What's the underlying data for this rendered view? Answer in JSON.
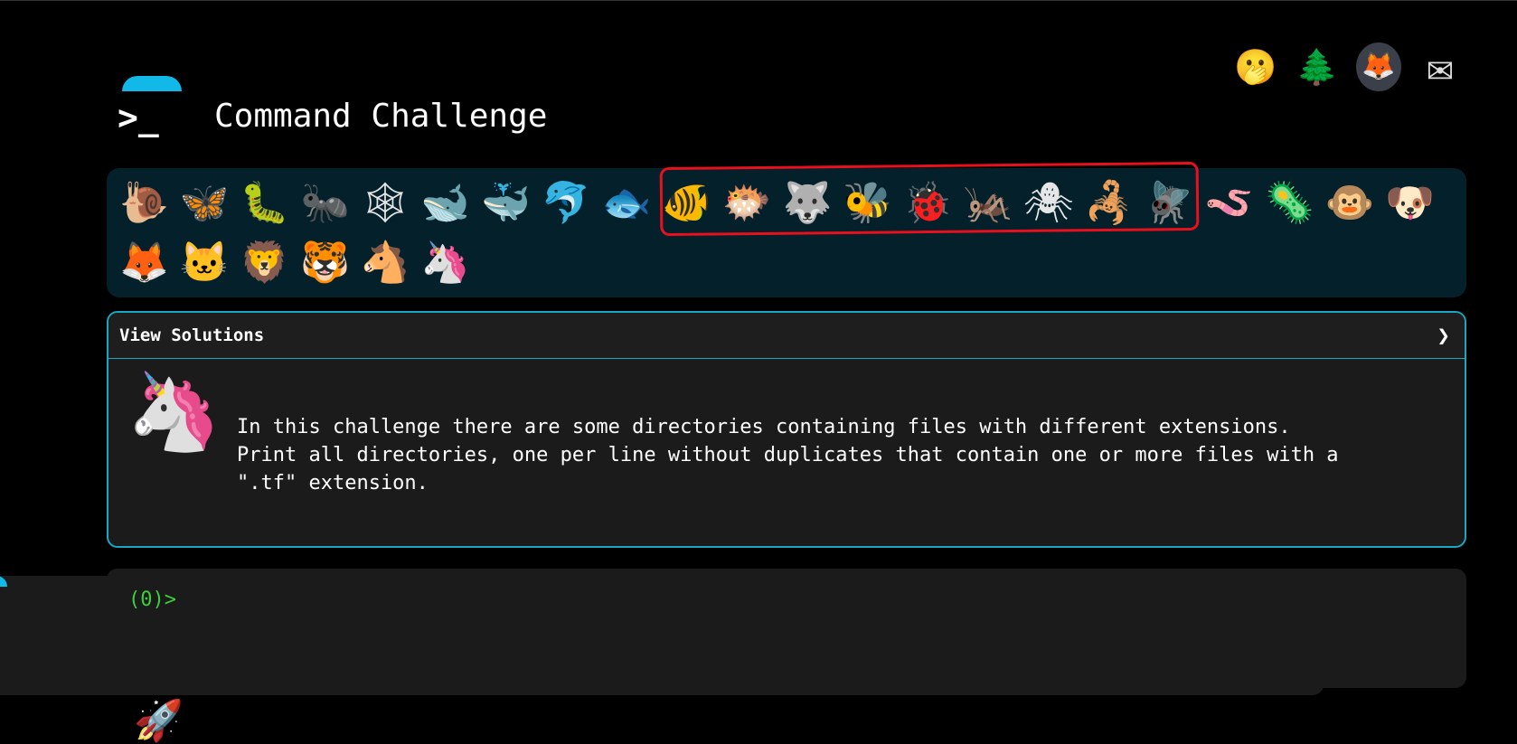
{
  "site": {
    "title": "Command Challenge",
    "logo_glyph": ">_"
  },
  "top_nav": {
    "items": [
      {
        "name": "terminal-icon",
        "glyph": ">_"
      },
      {
        "name": "shushing-face-icon",
        "glyph": "🫢"
      },
      {
        "name": "tree-icon",
        "glyph": "🌲"
      },
      {
        "name": "gitlab-icon",
        "glyph": "🦊"
      },
      {
        "name": "mail-icon",
        "glyph": "✉"
      }
    ]
  },
  "animals": {
    "row1": [
      {
        "name": "snail-icon",
        "glyph": "🐌"
      },
      {
        "name": "butterfly-icon",
        "glyph": "🦋"
      },
      {
        "name": "caterpillar-icon",
        "glyph": "🐛"
      },
      {
        "name": "ant-icon",
        "glyph": "🐜"
      },
      {
        "name": "spider-web-icon",
        "glyph": "🕸"
      },
      {
        "name": "whale-icon",
        "glyph": "🐋"
      },
      {
        "name": "spouting-whale-icon",
        "glyph": "🐳"
      },
      {
        "name": "dolphin-icon",
        "glyph": "🐬"
      },
      {
        "name": "fish-icon",
        "glyph": "🐟"
      },
      {
        "name": "tropical-fish-icon",
        "glyph": "🐠"
      },
      {
        "name": "blowfish-icon",
        "glyph": "🐡"
      },
      {
        "name": "wolf-icon",
        "glyph": "🐺"
      },
      {
        "name": "bee-icon",
        "glyph": "🐝"
      },
      {
        "name": "ladybug-icon",
        "glyph": "🐞"
      },
      {
        "name": "cricket-icon",
        "glyph": "🦗"
      },
      {
        "name": "spider-icon",
        "glyph": "🕷"
      },
      {
        "name": "scorpion-icon",
        "glyph": "🦂"
      },
      {
        "name": "fly-icon",
        "glyph": "🪰"
      },
      {
        "name": "worm-icon",
        "glyph": "🪱"
      },
      {
        "name": "microbe-icon",
        "glyph": "🦠"
      },
      {
        "name": "monkey-icon",
        "glyph": "🐵"
      },
      {
        "name": "dog-icon",
        "glyph": "🐶"
      }
    ],
    "row2": [
      {
        "name": "fox-icon",
        "glyph": "🦊"
      },
      {
        "name": "cat-icon",
        "glyph": "🐱"
      },
      {
        "name": "lion-icon",
        "glyph": "🦁"
      },
      {
        "name": "tiger-icon",
        "glyph": "🐯"
      },
      {
        "name": "horse-icon",
        "glyph": "🐴"
      },
      {
        "name": "unicorn-icon",
        "glyph": "🦄"
      }
    ]
  },
  "solutions": {
    "label": "View Solutions",
    "chevron": "❯",
    "icon_glyph": "🦄",
    "description": "In this challenge there are some directories containing files with different extensions.\nPrint all directories, one per line without duplicates that contain one or more files with a\n\".tf\" extension."
  },
  "terminal": {
    "prompt": "(0)>"
  },
  "footer": {
    "rocket_glyph": "🚀"
  },
  "colors": {
    "accent": "#1ba6c2",
    "dome": "#12b8e8",
    "prompt": "#3bd13b",
    "highlight": "#e8101c"
  }
}
